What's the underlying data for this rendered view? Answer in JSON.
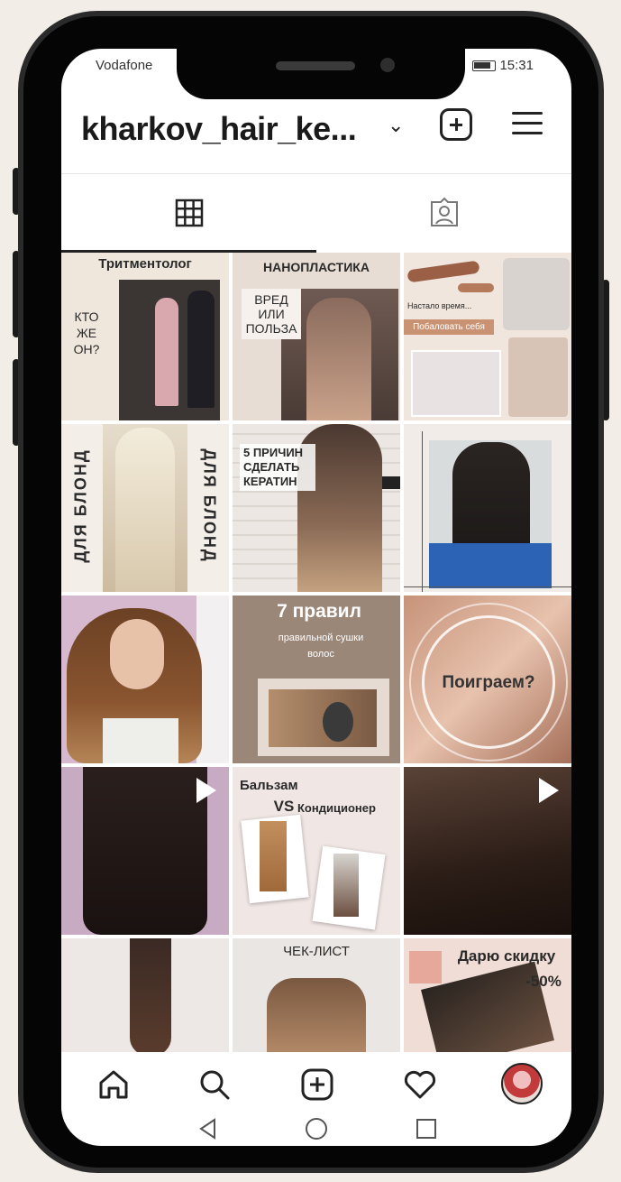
{
  "status_bar": {
    "carrier": "Vodafone",
    "time": "15:31"
  },
  "header": {
    "username": "kharkov_hair_ke..."
  },
  "tiles": [
    {
      "title": "Тритментолог",
      "side_text": "КТО ЖЕ ОН?"
    },
    {
      "title": "НАНОПЛАСТИКА",
      "side_text": "ВРЕД ИЛИ ПОЛЬЗА"
    },
    {
      "line1": "Настало время...",
      "line2": "Побаловать себя"
    },
    {
      "left_vertical": "ДЛЯ БЛОНД",
      "right_vertical": "ДЛЯ БЛОНД"
    },
    {
      "text": "5 ПРИЧИН СДЕЛАТЬ КЕРАТИН"
    },
    {},
    {},
    {
      "title": "7 правил",
      "subtitle": "правильной сушки волос"
    },
    {
      "text": "Поиграем?"
    },
    {},
    {
      "line1": "Бальзам",
      "vs": "VS",
      "line2": "Кондиционер"
    },
    {},
    {},
    {
      "title": "ЧЕК-ЛИСТ"
    },
    {
      "title": "Дарю скидку",
      "discount": "-50%"
    }
  ],
  "colors": {
    "accent": "#222222",
    "beige": "#e9ddd2",
    "tile_bg": "#f2ebe4"
  }
}
